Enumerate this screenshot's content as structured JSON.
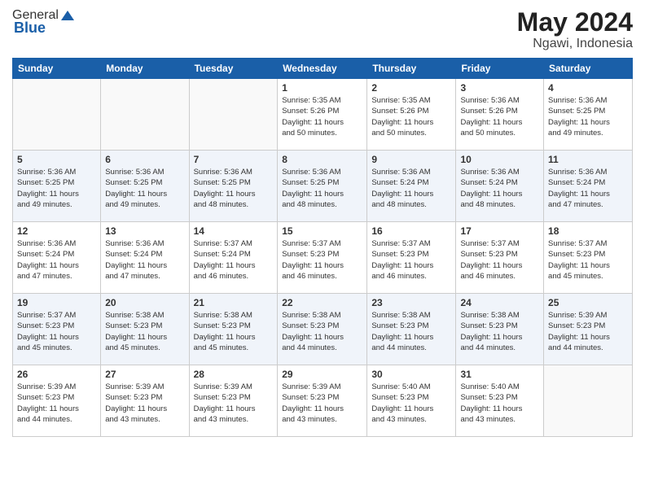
{
  "header": {
    "logo_general": "General",
    "logo_blue": "Blue",
    "title": "May 2024",
    "subtitle": "Ngawi, Indonesia"
  },
  "days_of_week": [
    "Sunday",
    "Monday",
    "Tuesday",
    "Wednesday",
    "Thursday",
    "Friday",
    "Saturday"
  ],
  "weeks": [
    [
      {
        "day": "",
        "info": ""
      },
      {
        "day": "",
        "info": ""
      },
      {
        "day": "",
        "info": ""
      },
      {
        "day": "1",
        "info": "Sunrise: 5:35 AM\nSunset: 5:26 PM\nDaylight: 11 hours\nand 50 minutes."
      },
      {
        "day": "2",
        "info": "Sunrise: 5:35 AM\nSunset: 5:26 PM\nDaylight: 11 hours\nand 50 minutes."
      },
      {
        "day": "3",
        "info": "Sunrise: 5:36 AM\nSunset: 5:26 PM\nDaylight: 11 hours\nand 50 minutes."
      },
      {
        "day": "4",
        "info": "Sunrise: 5:36 AM\nSunset: 5:25 PM\nDaylight: 11 hours\nand 49 minutes."
      }
    ],
    [
      {
        "day": "5",
        "info": "Sunrise: 5:36 AM\nSunset: 5:25 PM\nDaylight: 11 hours\nand 49 minutes."
      },
      {
        "day": "6",
        "info": "Sunrise: 5:36 AM\nSunset: 5:25 PM\nDaylight: 11 hours\nand 49 minutes."
      },
      {
        "day": "7",
        "info": "Sunrise: 5:36 AM\nSunset: 5:25 PM\nDaylight: 11 hours\nand 48 minutes."
      },
      {
        "day": "8",
        "info": "Sunrise: 5:36 AM\nSunset: 5:25 PM\nDaylight: 11 hours\nand 48 minutes."
      },
      {
        "day": "9",
        "info": "Sunrise: 5:36 AM\nSunset: 5:24 PM\nDaylight: 11 hours\nand 48 minutes."
      },
      {
        "day": "10",
        "info": "Sunrise: 5:36 AM\nSunset: 5:24 PM\nDaylight: 11 hours\nand 48 minutes."
      },
      {
        "day": "11",
        "info": "Sunrise: 5:36 AM\nSunset: 5:24 PM\nDaylight: 11 hours\nand 47 minutes."
      }
    ],
    [
      {
        "day": "12",
        "info": "Sunrise: 5:36 AM\nSunset: 5:24 PM\nDaylight: 11 hours\nand 47 minutes."
      },
      {
        "day": "13",
        "info": "Sunrise: 5:36 AM\nSunset: 5:24 PM\nDaylight: 11 hours\nand 47 minutes."
      },
      {
        "day": "14",
        "info": "Sunrise: 5:37 AM\nSunset: 5:24 PM\nDaylight: 11 hours\nand 46 minutes."
      },
      {
        "day": "15",
        "info": "Sunrise: 5:37 AM\nSunset: 5:23 PM\nDaylight: 11 hours\nand 46 minutes."
      },
      {
        "day": "16",
        "info": "Sunrise: 5:37 AM\nSunset: 5:23 PM\nDaylight: 11 hours\nand 46 minutes."
      },
      {
        "day": "17",
        "info": "Sunrise: 5:37 AM\nSunset: 5:23 PM\nDaylight: 11 hours\nand 46 minutes."
      },
      {
        "day": "18",
        "info": "Sunrise: 5:37 AM\nSunset: 5:23 PM\nDaylight: 11 hours\nand 45 minutes."
      }
    ],
    [
      {
        "day": "19",
        "info": "Sunrise: 5:37 AM\nSunset: 5:23 PM\nDaylight: 11 hours\nand 45 minutes."
      },
      {
        "day": "20",
        "info": "Sunrise: 5:38 AM\nSunset: 5:23 PM\nDaylight: 11 hours\nand 45 minutes."
      },
      {
        "day": "21",
        "info": "Sunrise: 5:38 AM\nSunset: 5:23 PM\nDaylight: 11 hours\nand 45 minutes."
      },
      {
        "day": "22",
        "info": "Sunrise: 5:38 AM\nSunset: 5:23 PM\nDaylight: 11 hours\nand 44 minutes."
      },
      {
        "day": "23",
        "info": "Sunrise: 5:38 AM\nSunset: 5:23 PM\nDaylight: 11 hours\nand 44 minutes."
      },
      {
        "day": "24",
        "info": "Sunrise: 5:38 AM\nSunset: 5:23 PM\nDaylight: 11 hours\nand 44 minutes."
      },
      {
        "day": "25",
        "info": "Sunrise: 5:39 AM\nSunset: 5:23 PM\nDaylight: 11 hours\nand 44 minutes."
      }
    ],
    [
      {
        "day": "26",
        "info": "Sunrise: 5:39 AM\nSunset: 5:23 PM\nDaylight: 11 hours\nand 44 minutes."
      },
      {
        "day": "27",
        "info": "Sunrise: 5:39 AM\nSunset: 5:23 PM\nDaylight: 11 hours\nand 43 minutes."
      },
      {
        "day": "28",
        "info": "Sunrise: 5:39 AM\nSunset: 5:23 PM\nDaylight: 11 hours\nand 43 minutes."
      },
      {
        "day": "29",
        "info": "Sunrise: 5:39 AM\nSunset: 5:23 PM\nDaylight: 11 hours\nand 43 minutes."
      },
      {
        "day": "30",
        "info": "Sunrise: 5:40 AM\nSunset: 5:23 PM\nDaylight: 11 hours\nand 43 minutes."
      },
      {
        "day": "31",
        "info": "Sunrise: 5:40 AM\nSunset: 5:23 PM\nDaylight: 11 hours\nand 43 minutes."
      },
      {
        "day": "",
        "info": ""
      }
    ]
  ]
}
